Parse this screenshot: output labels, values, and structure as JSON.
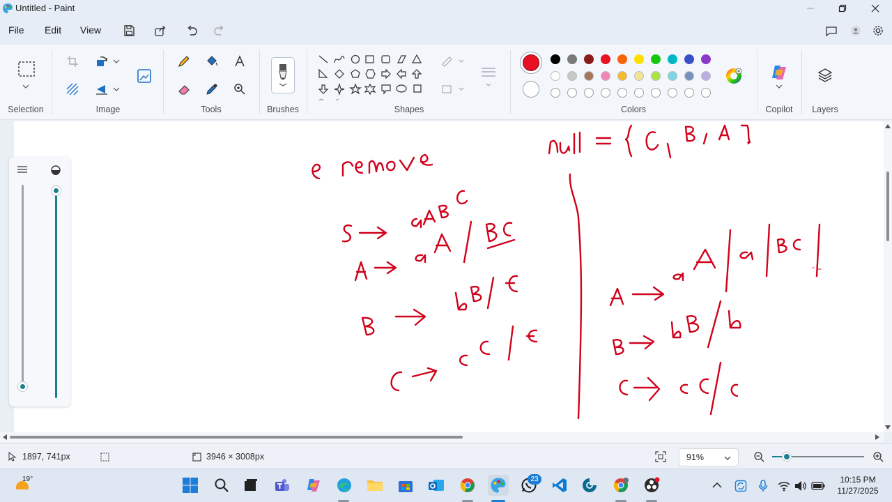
{
  "window": {
    "title": "Untitled - Paint",
    "app_icon": "paint-palette-icon"
  },
  "menu": {
    "file": "File",
    "edit": "Edit",
    "view": "View"
  },
  "ribbon": {
    "groups": {
      "selection": "Selection",
      "image": "Image",
      "tools": "Tools",
      "brushes": "Brushes",
      "shapes": "Shapes",
      "colors": "Colors",
      "copilot": "Copilot",
      "layers": "Layers"
    },
    "active_color_1": "#e81123",
    "active_color_2": "#ffffff",
    "palette_row1": [
      "#000000",
      "#7a7a7a",
      "#8b1a1a",
      "#e81123",
      "#f7630c",
      "#fce100",
      "#16c60c",
      "#00b7c3",
      "#3a50c9",
      "#8a3ac9"
    ],
    "palette_row2": [
      "#ffffff",
      "#c3c3c3",
      "#9c6a4a",
      "#f27bb0",
      "#f9b418",
      "#f2e28a",
      "#a4e22e",
      "#6fd3e2",
      "#6a87b8",
      "#b4a6e0"
    ]
  },
  "drawing": {
    "ink_color": "#d0021b",
    "handwritten_text": [
      "null = {C , B , A}",
      "e remove",
      "S → aABC",
      "A → aA | BC",
      "B → bB | E",
      "C → cC | E",
      "A → aA | a | BC |",
      "B → bB / b",
      "C → cC / c"
    ]
  },
  "status": {
    "cursor_position": "1897, 741px",
    "canvas_size": "3946 × 3008px",
    "zoom": "91%"
  },
  "taskbar": {
    "weather_temp": "19°",
    "whatsapp_badge": "23",
    "time": "10:15 PM",
    "date": "11/27/2025"
  }
}
